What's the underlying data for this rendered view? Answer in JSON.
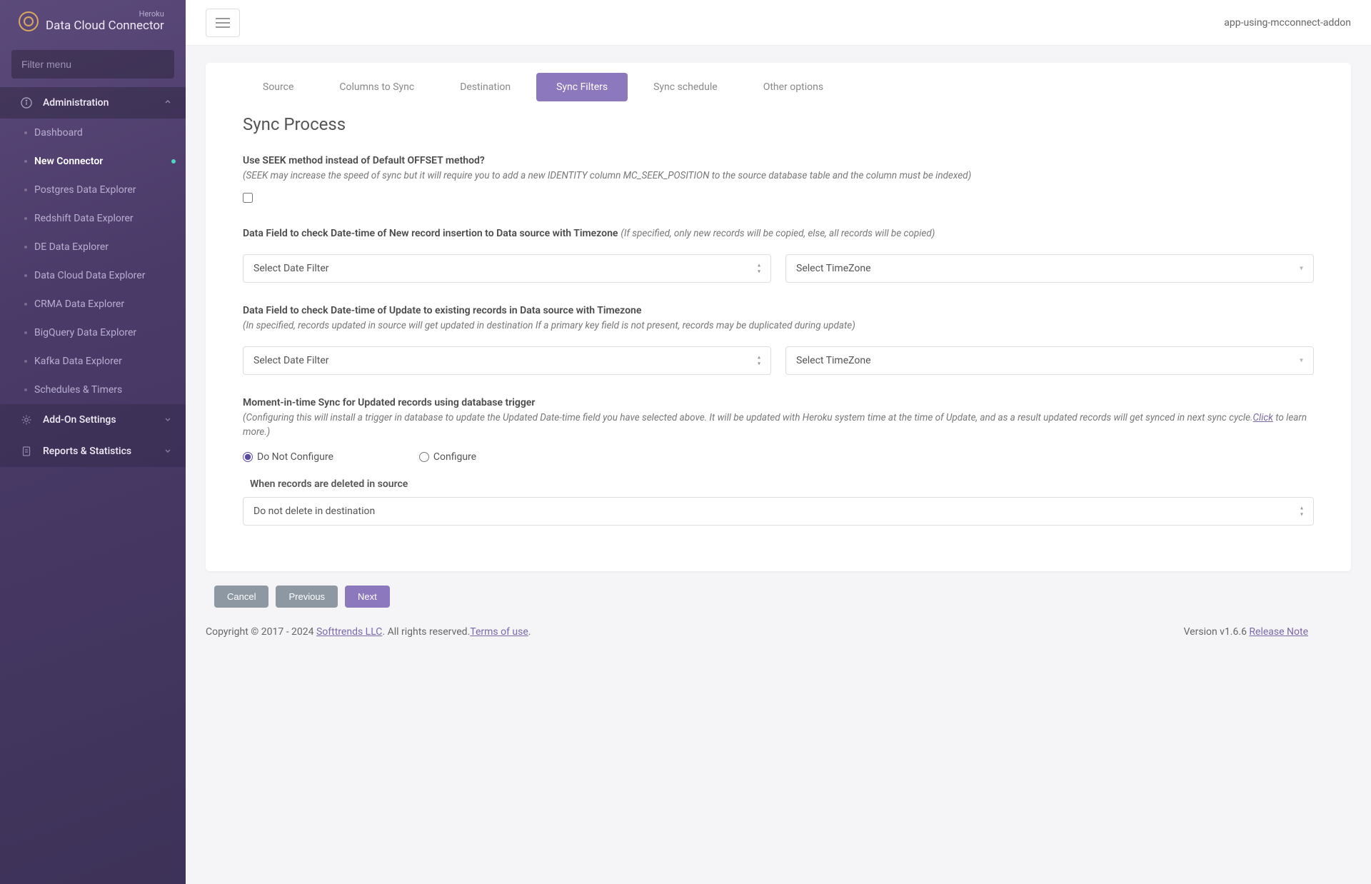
{
  "brand": {
    "sub": "Heroku",
    "title": "Data Cloud Connector"
  },
  "sidebar": {
    "filter_placeholder": "Filter menu",
    "sections": [
      {
        "label": "Administration",
        "items": [
          {
            "label": "Dashboard"
          },
          {
            "label": "New Connector"
          },
          {
            "label": "Postgres Data Explorer"
          },
          {
            "label": "Redshift Data Explorer"
          },
          {
            "label": "DE Data Explorer"
          },
          {
            "label": "Data Cloud Data Explorer"
          },
          {
            "label": "CRMA Data Explorer"
          },
          {
            "label": "BigQuery Data Explorer"
          },
          {
            "label": "Kafka Data Explorer"
          },
          {
            "label": "Schedules & Timers"
          }
        ]
      },
      {
        "label": "Add-On Settings"
      },
      {
        "label": "Reports & Statistics"
      }
    ]
  },
  "topbar": {
    "app_label": "app-using-mcconnect-addon"
  },
  "tabs": {
    "items": [
      "Source",
      "Columns to Sync",
      "Destination",
      "Sync Filters",
      "Sync schedule",
      "Other options"
    ]
  },
  "page": {
    "title": "Sync Process",
    "seek": {
      "label": "Use SEEK method instead of Default OFFSET method?",
      "note": "(SEEK may increase the speed of sync but it will require you to add a new IDENTITY column MC_SEEK_POSITION to the source database table and the column must be indexed)"
    },
    "new_record": {
      "label": "Data Field to check Date-time of New record insertion to Data source with Timezone",
      "note": "(If specified, only new records will be copied, else, all records will be copied)"
    },
    "update_record": {
      "label": "Data Field to check Date-time of Update to existing records in Data source with Timezone",
      "note": "(In specified, records updated in source will get updated in destination If a primary key field is not present, records may be duplicated during update)"
    },
    "moment": {
      "label": "Moment-in-time Sync for Updated records using database trigger",
      "note_prefix": "(Configuring this will install a trigger in database to update the Updated Date-time field you have selected above. It will be updated with Heroku system time at the time of Update, and as a result updated records will get synced in next sync cycle.",
      "note_link": "Click",
      "note_suffix": " to learn more.)",
      "radio_no": "Do Not Configure",
      "radio_yes": "Configure"
    },
    "delete": {
      "label": "When records are deleted in source",
      "value": "Do not delete in destination"
    },
    "selects": {
      "date_filter": "Select Date Filter",
      "timezone": "Select TimeZone"
    },
    "actions": {
      "cancel": "Cancel",
      "previous": "Previous",
      "next": "Next"
    }
  },
  "footer": {
    "copyright_prefix": "Copyright © 2017 - 2024 ",
    "company": "Softtrends LLC",
    "copyright_suffix": ". All rights reserved.",
    "terms": "Terms of use",
    "version": "Version v1.6.6 ",
    "release_notes": " Release Note"
  }
}
